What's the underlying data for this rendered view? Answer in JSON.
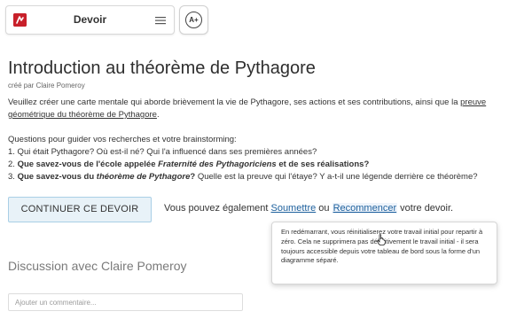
{
  "header": {
    "logo": "logo-icon",
    "title": "Devoir",
    "menu_icon": "hamburger-icon",
    "accessibility_icon": "text-size-icon",
    "accessibility_label": "A+"
  },
  "assignment": {
    "title": "Introduction au théorème de Pythagore",
    "author": "créé par Claire Pomeroy",
    "intro_text": "Veuillez créer une carte mentale qui aborde brièvement la vie de Pythagore, ses actions et ses contributions, ainsi que la ",
    "intro_link": "preuve géométrique du théorème de Pythagore",
    "intro_end": ".",
    "questions_header": "Questions pour guider vos recherches et votre brainstorming:",
    "q1": "1. Qui était Pythagore? Où est-il né? Qui l'a influencé dans ses premières années?",
    "q2_prefix": "2. ",
    "q2_bold1": "Que savez-vous de l'école appelée ",
    "q2_italic": "Fraternité des Pythagoriciens",
    "q2_bold2": " et de ses réalisations?",
    "q3_prefix": "3. ",
    "q3_bold1": "Que savez-vous du ",
    "q3_italic": "théorème de Pythagore",
    "q3_bold2": "?",
    "q3_rest": " Quelle est la preuve qui l'étaye? Y a-t-il une légende derrière ce théorème?"
  },
  "actions": {
    "continue_label": "CONTINUER CE DEVOIR",
    "text_before": "Vous pouvez également ",
    "submit_link": "Soumettre",
    "text_middle": " ou ",
    "restart_link": "Recommencer",
    "text_after": " votre devoir."
  },
  "tooltip": {
    "text": "En redémarrant, vous réinitialiserez votre travail initial pour repartir à zéro. Cela ne supprimera pas définitivement le travail initial - il sera toujours accessible depuis votre tableau de bord sous la forme d'un diagramme séparé."
  },
  "discussion": {
    "title": "Discussion avec Claire Pomeroy",
    "comment_placeholder": "Ajouter un commentaire..."
  },
  "colors": {
    "brand": "#c8202a",
    "link": "#1c5f9c",
    "button_bg": "#e8f2f8",
    "button_border": "#a9cfe6"
  }
}
